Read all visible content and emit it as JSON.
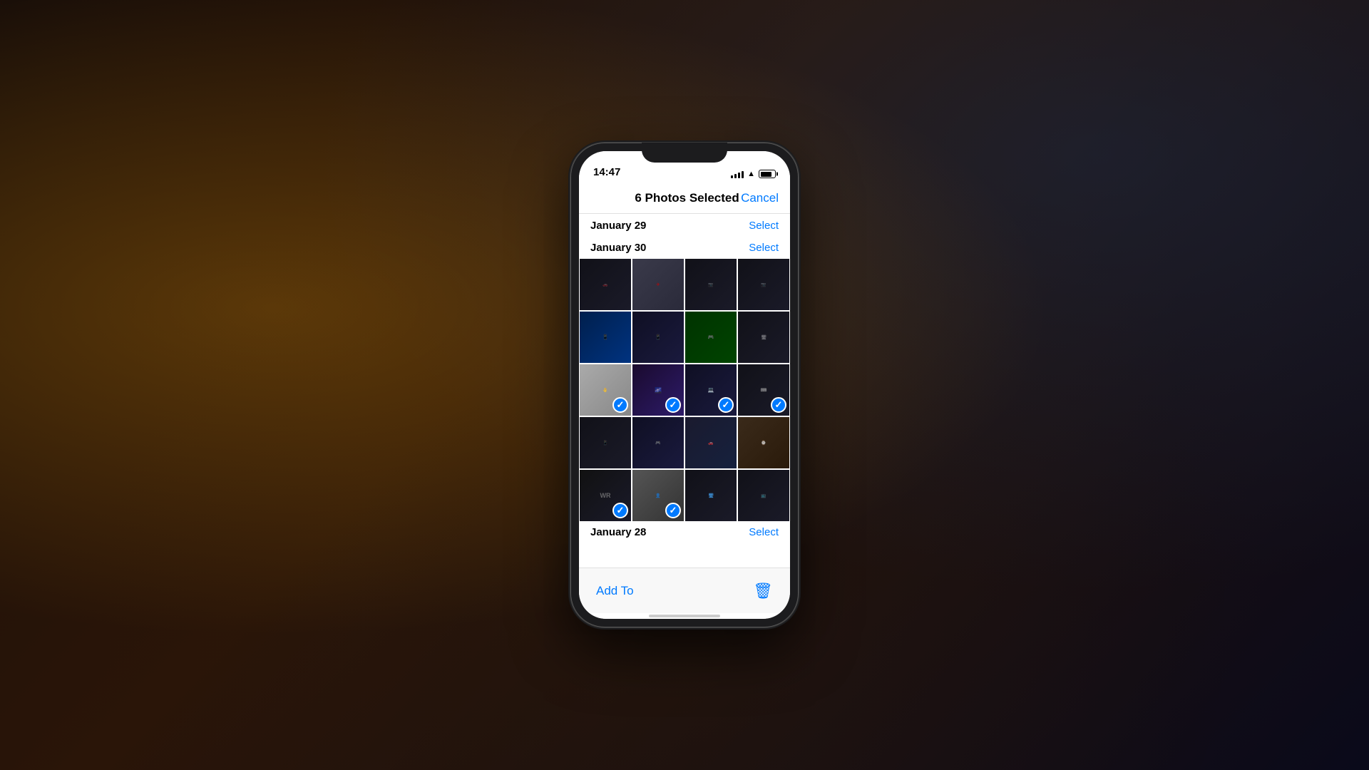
{
  "background": {
    "colors": [
      "#1a0f08",
      "#c8820a",
      "#1a3a66"
    ]
  },
  "phone": {
    "status_bar": {
      "time": "14:47",
      "signal_bars": [
        4,
        6,
        8,
        10,
        12
      ],
      "wifi": true,
      "battery": 80
    },
    "nav_bar": {
      "title": "6 Photos Selected",
      "cancel_label": "Cancel"
    },
    "sections": [
      {
        "id": "jan29",
        "title": "January 29",
        "select_label": "Select"
      },
      {
        "id": "jan30",
        "title": "January 30",
        "select_label": "Select"
      }
    ],
    "photos": [
      {
        "id": 1,
        "theme": "dark-car",
        "selected": false,
        "row": 1,
        "col": 1
      },
      {
        "id": 2,
        "theme": "grey-photo",
        "selected": false,
        "row": 1,
        "col": 2
      },
      {
        "id": 3,
        "theme": "dark-car",
        "selected": false,
        "row": 1,
        "col": 3
      },
      {
        "id": 4,
        "theme": "dark-car",
        "selected": false,
        "row": 1,
        "col": 4
      },
      {
        "id": 5,
        "theme": "blue-screen",
        "selected": false,
        "row": 2,
        "col": 1
      },
      {
        "id": 6,
        "theme": "tech-photo",
        "selected": false,
        "row": 2,
        "col": 2
      },
      {
        "id": 7,
        "theme": "green-screen",
        "selected": false,
        "row": 2,
        "col": 3
      },
      {
        "id": 8,
        "theme": "dark-car",
        "selected": false,
        "row": 2,
        "col": 4
      },
      {
        "id": 9,
        "theme": "light-grey",
        "selected": true,
        "row": 3,
        "col": 1
      },
      {
        "id": 10,
        "theme": "purple-photo",
        "selected": true,
        "row": 3,
        "col": 2
      },
      {
        "id": 11,
        "theme": "tech-photo",
        "selected": true,
        "row": 3,
        "col": 3
      },
      {
        "id": 12,
        "theme": "dark-car",
        "selected": true,
        "row": 3,
        "col": 4
      },
      {
        "id": 13,
        "theme": "dark-car",
        "selected": false,
        "row": 4,
        "col": 1
      },
      {
        "id": 14,
        "theme": "tech-photo",
        "selected": false,
        "row": 4,
        "col": 2
      },
      {
        "id": 15,
        "theme": "car-interior",
        "selected": false,
        "row": 4,
        "col": 3
      },
      {
        "id": 16,
        "theme": "hand-photo",
        "selected": false,
        "row": 4,
        "col": 4
      },
      {
        "id": 17,
        "theme": "dark-car",
        "selected": true,
        "row": 5,
        "col": 1
      },
      {
        "id": 18,
        "theme": "light-grey",
        "selected": true,
        "row": 5,
        "col": 2
      },
      {
        "id": 19,
        "theme": "dark-car",
        "selected": false,
        "row": 5,
        "col": 3
      },
      {
        "id": 20,
        "theme": "dark-car",
        "selected": false,
        "row": 5,
        "col": 4
      }
    ],
    "bottom_toolbar": {
      "add_to_label": "Add To",
      "trash_icon": "🗑"
    },
    "partial_section": {
      "title": "January 28",
      "select_label": "Select"
    }
  }
}
